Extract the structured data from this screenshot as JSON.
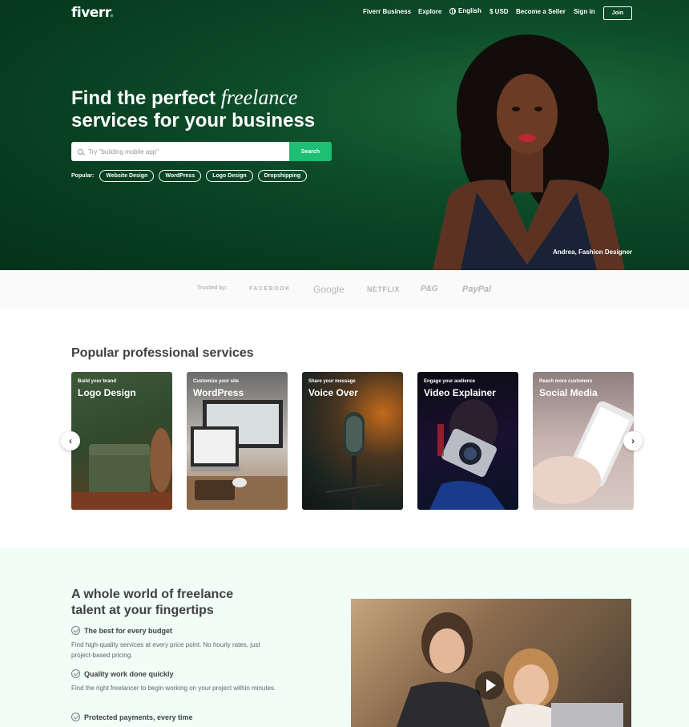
{
  "nav": {
    "logo": "fiverr",
    "logo_dot": ".",
    "business": "Fiverr Business",
    "explore": "Explore",
    "language": "English",
    "currency": "$ USD",
    "become_seller": "Become a Seller",
    "sign_in": "Sign in",
    "join": "Join"
  },
  "hero": {
    "title_line1_pre": "Find the perfect ",
    "title_line1_italic": "freelance",
    "title_line2": "services for your business",
    "search_placeholder": "Try \"building mobile app\"",
    "search_button": "Search",
    "popular_label": "Popular:",
    "popular_tags": [
      "Website Design",
      "WordPress",
      "Logo Design",
      "Dropshipping"
    ],
    "caption": "Andrea, Fashion Designer"
  },
  "trusted": {
    "label": "Trusted by:",
    "brands": [
      "FACEBOOK",
      "Google",
      "NETFLIX",
      "P&G",
      "PayPal"
    ]
  },
  "popular_services": {
    "title": "Popular professional services",
    "cards": [
      {
        "subtitle": "Build your brand",
        "title": "Logo Design"
      },
      {
        "subtitle": "Customize your site",
        "title": "WordPress"
      },
      {
        "subtitle": "Share your message",
        "title": "Voice Over"
      },
      {
        "subtitle": "Engage your audience",
        "title": "Video Explainer"
      },
      {
        "subtitle": "Reach more customers",
        "title": "Social Media"
      }
    ],
    "prev_arrow": "‹",
    "next_arrow": "›"
  },
  "world": {
    "title": "A whole world of freelance talent at your fingertips",
    "features": [
      {
        "heading": "The best for every budget",
        "text": "Find high-quality services at every price point. No hourly rates, just project-based pricing."
      },
      {
        "heading": "Quality work done quickly",
        "text": "Find the right freelancer to begin working on your project within minutes."
      },
      {
        "heading": "Protected payments, every time",
        "text": ""
      }
    ]
  },
  "colors": {
    "brand_green": "#1dbf73",
    "hero_dark_green": "#0e4d2a",
    "text": "#404145"
  }
}
